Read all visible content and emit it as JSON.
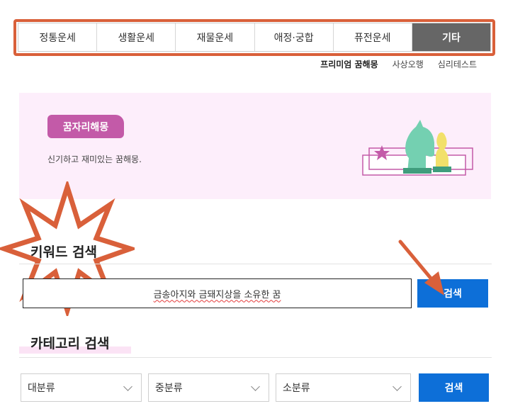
{
  "tabs": [
    {
      "label": "정통운세"
    },
    {
      "label": "생활운세"
    },
    {
      "label": "재물운세"
    },
    {
      "label": "애정·궁합"
    },
    {
      "label": "퓨전운세"
    },
    {
      "label": "기타"
    }
  ],
  "subnav": [
    "프리미엄 꿈해몽",
    "사상오행",
    "심리테스트"
  ],
  "banner": {
    "badge": "꿈자리해몽",
    "description": "신기하고 재미있는 꿈해몽."
  },
  "keyword_search": {
    "title": "키워드 검색",
    "value": "금송아지와 금돼지상을 소유한 꿈",
    "button": "검색"
  },
  "category_search": {
    "title": "카테고리 검색",
    "selects": [
      "대분류",
      "중분류",
      "소분류"
    ],
    "button": "검색"
  },
  "colors": {
    "annotation": "#d9603a",
    "accent": "#0d6fd8",
    "badge": "#c35aa8",
    "active_tab": "#666666",
    "banner_bg": "#fdeefb"
  }
}
